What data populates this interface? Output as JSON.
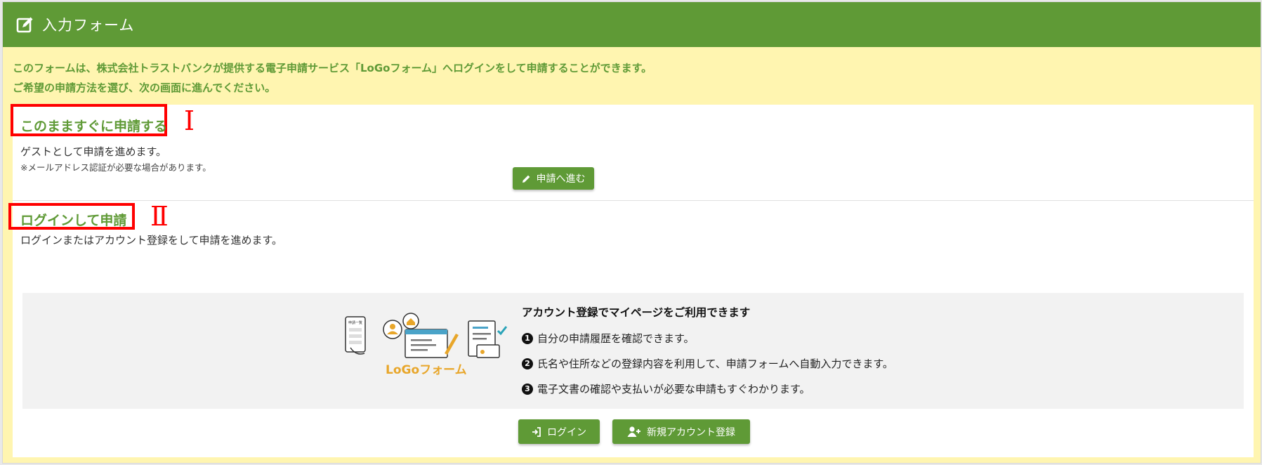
{
  "header": {
    "title": "入力フォーム",
    "icon": "edit-icon"
  },
  "notice": {
    "line1": "このフォームは、株式会社トラストバンクが提供する電子申請サービス「LoGoフォーム」へログインをして申請することができます。",
    "line2": "ご希望の申請方法を選び、次の画面に進んでください。"
  },
  "section_guest": {
    "title": "このまますぐに申請する",
    "marker": "Ⅰ",
    "desc": "ゲストとして申請を進めます。",
    "note": "※メールアドレス認証が必要な場合があります。",
    "button_label": "申請へ進む"
  },
  "section_login": {
    "title": "ログインして申請",
    "marker": "Ⅱ",
    "desc": "ログインまたはアカウント登録をして申請を進めます。",
    "promo": {
      "logo_text": "LoGoフォーム",
      "illus_label": "申請一覧",
      "title": "アカウント登録でマイページをご利用できます",
      "items": [
        {
          "num": "1",
          "text": "自分の申請履歴を確認できます。"
        },
        {
          "num": "2",
          "text": "氏名や住所などの登録内容を利用して、申請フォームへ自動入力できます。"
        },
        {
          "num": "3",
          "text": "電子文書の確認や支払いが必要な申請もすぐわかります。"
        }
      ]
    },
    "login_label": "ログイン",
    "register_label": "新規アカウント登録"
  },
  "colors": {
    "accent": "#5f9a36",
    "banner": "#fff5b0",
    "highlight": "#ff0000"
  }
}
